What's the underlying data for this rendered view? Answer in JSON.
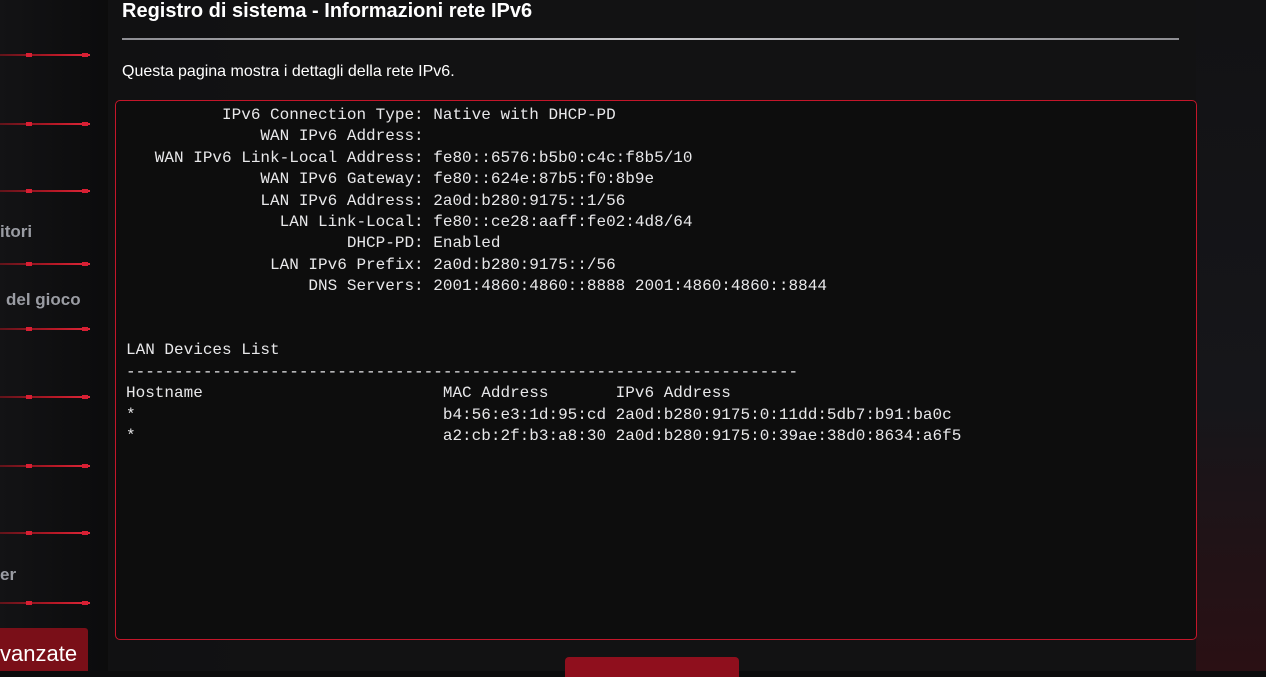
{
  "page": {
    "title": "Registro di sistema - Informazioni rete IPv6",
    "description": "Questa pagina mostra i dettagli della rete IPv6."
  },
  "sidebar": {
    "items": [
      {
        "label": "itori"
      },
      {
        "label": "del gioco"
      },
      {
        "label": "er"
      }
    ],
    "active_item": {
      "label": "vanzate"
    }
  },
  "colors": {
    "accent": "#c4162a",
    "active_bg": "#7a0f18",
    "sidebar_text": "#9a9ca3"
  },
  "log": {
    "text": "          IPv6 Connection Type: Native with DHCP-PD\n              WAN IPv6 Address:\n   WAN IPv6 Link-Local Address: fe80::6576:b5b0:c4c:f8b5/10\n              WAN IPv6 Gateway: fe80::624e:87b5:f0:8b9e\n              LAN IPv6 Address: 2a0d:b280:9175::1/56\n                LAN Link-Local: fe80::ce28:aaff:fe02:4d8/64\n                       DHCP-PD: Enabled\n               LAN IPv6 Prefix: 2a0d:b280:9175::/56\n                   DNS Servers: 2001:4860:4860::8888 2001:4860:4860::8844\n\n\nLAN Devices List\n----------------------------------------------------------------------\nHostname                         MAC Address       IPv6 Address\n*                                b4:56:e3:1d:95:cd 2a0d:b280:9175:0:11dd:5db7:b91:ba0c\n*                                a2:cb:2f:b3:a8:30 2a0d:b280:9175:0:39ae:38d0:8634:a6f5"
  }
}
